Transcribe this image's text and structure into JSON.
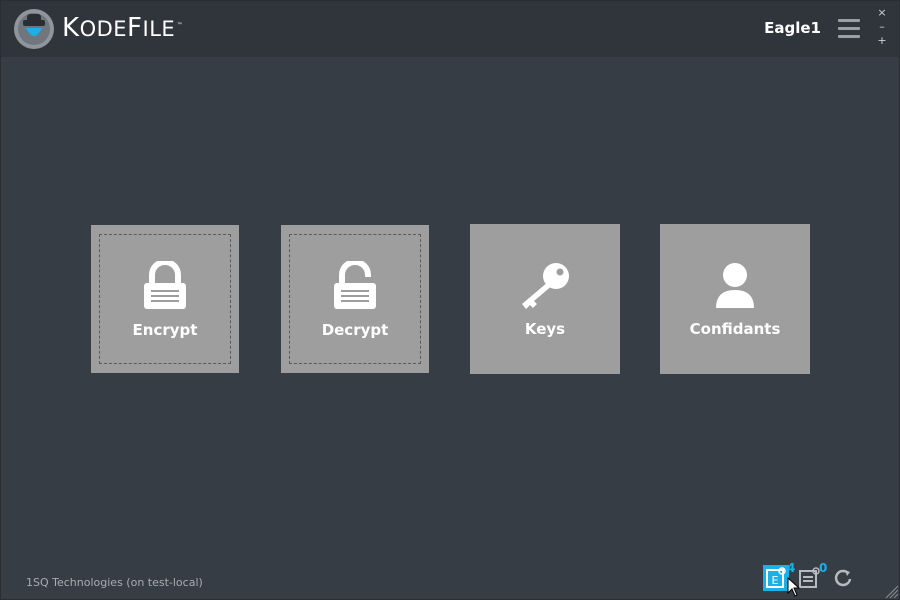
{
  "app": {
    "brand_k": "K",
    "brand_ode": "ODE",
    "brand_f": "F",
    "brand_ile": "ILE",
    "brand_tm": "™",
    "username": "Eagle1"
  },
  "window_controls": {
    "close": "×",
    "minimize": "–",
    "maximize": "+"
  },
  "tiles": [
    {
      "label": "Encrypt",
      "icon": "lock-icon"
    },
    {
      "label": "Decrypt",
      "icon": "unlock-icon"
    },
    {
      "label": "Keys",
      "icon": "key-icon"
    },
    {
      "label": "Confidants",
      "icon": "person-icon"
    }
  ],
  "footer": {
    "status": "1SQ Technologies (on test-local)"
  },
  "tray": {
    "encrypted_count": "4",
    "messages_count": "0"
  },
  "colors": {
    "accent": "#1ab0e8",
    "tile": "#9e9e9e",
    "background": "#373d44",
    "titlebar": "#30353b"
  }
}
